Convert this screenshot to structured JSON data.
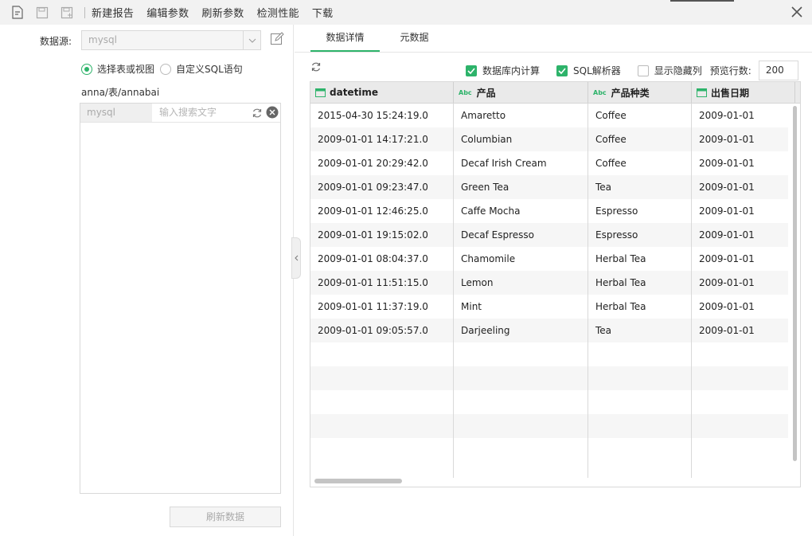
{
  "toolbar": {
    "icons": [
      "new-doc-icon",
      "save-icon",
      "save-as-icon"
    ],
    "buttons": [
      "新建报告",
      "编辑参数",
      "刷新参数",
      "检测性能",
      "下载"
    ]
  },
  "left": {
    "datasource_label": "数据源:",
    "datasource_value": "mysql",
    "radio_table": "选择表或视图",
    "radio_sql": "自定义SQL语句",
    "path": "anna/表/annabai",
    "tree_db": "mysql",
    "tree_search_placeholder": "输入搜索文字",
    "refresh_button": "刷新数据"
  },
  "right": {
    "tabs": [
      "数据详情",
      "元数据"
    ],
    "options": {
      "db_compute": "数据库内计算",
      "sql_parser": "SQL解析器",
      "show_hidden": "显示隐藏列",
      "preview_label": "预览行数:",
      "preview_value": "200"
    },
    "columns": [
      {
        "name": "datetime",
        "type": "date"
      },
      {
        "name": "产品",
        "type": "text"
      },
      {
        "name": "产品种类",
        "type": "text"
      },
      {
        "name": "出售日期",
        "type": "date"
      }
    ],
    "rows": [
      [
        "2015-04-30 15:24:19.0",
        "Amaretto",
        "Coffee",
        "2009-01-01"
      ],
      [
        "2009-01-01 14:17:21.0",
        "Columbian",
        "Coffee",
        "2009-01-01"
      ],
      [
        "2009-01-01 20:29:42.0",
        "Decaf Irish Cream",
        "Coffee",
        "2009-01-01"
      ],
      [
        "2009-01-01 09:23:47.0",
        "Green Tea",
        "Tea",
        "2009-01-01"
      ],
      [
        "2009-01-01 12:46:25.0",
        "Caffe Mocha",
        "Espresso",
        "2009-01-01"
      ],
      [
        "2009-01-01 19:15:02.0",
        "Decaf Espresso",
        "Espresso",
        "2009-01-01"
      ],
      [
        "2009-01-01 08:04:37.0",
        "Chamomile",
        "Herbal Tea",
        "2009-01-01"
      ],
      [
        "2009-01-01 11:51:15.0",
        "Lemon",
        "Herbal Tea",
        "2009-01-01"
      ],
      [
        "2009-01-01 11:37:19.0",
        "Mint",
        "Herbal Tea",
        "2009-01-01"
      ],
      [
        "2009-01-01 09:05:57.0",
        "Darjeeling",
        "Tea",
        "2009-01-01"
      ]
    ]
  },
  "colors": {
    "accent": "#2db36a"
  }
}
